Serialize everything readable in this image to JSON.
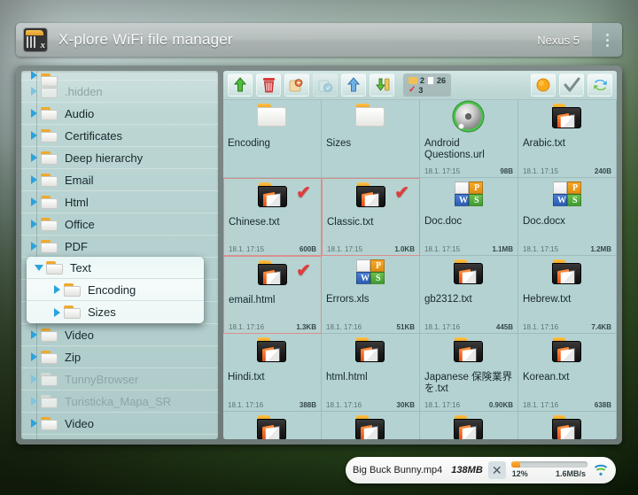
{
  "titlebar": {
    "app_icon": "xplore-app-icon",
    "title": "X-plore WiFi file manager",
    "device": "Nexus 5",
    "overflow_icon": "overflow-menu-icon"
  },
  "tree": {
    "items": [
      {
        "label": ".hidden",
        "state": "collapsed",
        "dim": true,
        "indent": 0
      },
      {
        "label": "Audio",
        "state": "collapsed",
        "dim": false,
        "indent": 0
      },
      {
        "label": "Certificates",
        "state": "collapsed",
        "dim": false,
        "indent": 0
      },
      {
        "label": "Deep hierarchy",
        "state": "collapsed",
        "dim": false,
        "indent": 0
      },
      {
        "label": "Email",
        "state": "collapsed",
        "dim": false,
        "indent": 0
      },
      {
        "label": "Html",
        "state": "collapsed",
        "dim": false,
        "indent": 0
      },
      {
        "label": "Office",
        "state": "collapsed",
        "dim": false,
        "indent": 0
      },
      {
        "label": "PDF",
        "state": "collapsed",
        "dim": false,
        "indent": 0
      },
      {
        "label": "Text",
        "state": "expanded",
        "dim": false,
        "indent": 0
      },
      {
        "label": "Encoding",
        "state": "collapsed",
        "dim": false,
        "indent": 1
      },
      {
        "label": "Sizes",
        "state": "collapsed",
        "dim": false,
        "indent": 1
      },
      {
        "label": "Video",
        "state": "collapsed",
        "dim": false,
        "indent": 0
      },
      {
        "label": "Zip",
        "state": "collapsed",
        "dim": false,
        "indent": 0
      },
      {
        "label": "TunnyBrowser",
        "state": "collapsed",
        "dim": true,
        "indent": 0
      },
      {
        "label": "Turisticka_Mapa_SR",
        "state": "collapsed",
        "dim": true,
        "indent": 0
      },
      {
        "label": "Video",
        "state": "collapsed",
        "dim": false,
        "indent": 0
      }
    ],
    "popup": {
      "items": [
        {
          "label": "Text",
          "state": "expanded",
          "indent": 0
        },
        {
          "label": "Encoding",
          "state": "collapsed",
          "indent": 1
        },
        {
          "label": "Sizes",
          "state": "collapsed",
          "indent": 1
        }
      ]
    }
  },
  "toolbar": {
    "buttons": [
      {
        "name": "up-folder-button",
        "icon": "green-up-arrow-icon",
        "dimmed": false
      },
      {
        "name": "delete-button",
        "icon": "trash-icon",
        "dimmed": false
      },
      {
        "name": "copy-button",
        "icon": "copy-icon",
        "dimmed": false
      },
      {
        "name": "paste-button",
        "icon": "paste-icon",
        "dimmed": true
      },
      {
        "name": "upload-button",
        "icon": "blue-up-arrow-icon",
        "dimmed": false
      },
      {
        "name": "download-button",
        "icon": "download-icon",
        "dimmed": false
      }
    ],
    "counts": {
      "folders": "2",
      "files": "26",
      "checked": "3"
    },
    "right_buttons": [
      {
        "name": "theme-button",
        "icon": "orange-circle-icon"
      },
      {
        "name": "select-all-button",
        "icon": "checkmark-icon"
      },
      {
        "name": "refresh-button",
        "icon": "refresh-arrows-icon"
      }
    ]
  },
  "files": {
    "items": [
      {
        "name": "Encoding",
        "kind": "folder",
        "date": "",
        "size": "",
        "selected": false,
        "checked": false
      },
      {
        "name": "Sizes",
        "kind": "folder",
        "date": "",
        "size": "",
        "selected": false,
        "checked": false
      },
      {
        "name": "Android Questions.url",
        "kind": "url",
        "date": "18.1. 17:15",
        "size": "98B",
        "selected": false,
        "checked": false
      },
      {
        "name": "Arabic.txt",
        "kind": "text",
        "date": "18.1. 17:15",
        "size": "240B",
        "selected": false,
        "checked": false
      },
      {
        "name": "Chinese.txt",
        "kind": "text",
        "date": "18.1. 17:15",
        "size": "600B",
        "selected": true,
        "checked": true
      },
      {
        "name": "Classic.txt",
        "kind": "text",
        "date": "18.1. 17:15",
        "size": "1.0KB",
        "selected": true,
        "checked": true
      },
      {
        "name": "Doc.doc",
        "kind": "office",
        "date": "18.1. 17:15",
        "size": "1.1MB",
        "selected": false,
        "checked": false
      },
      {
        "name": "Doc.docx",
        "kind": "office",
        "date": "18.1. 17:15",
        "size": "1.2MB",
        "selected": false,
        "checked": false
      },
      {
        "name": "email.html",
        "kind": "text",
        "date": "18.1. 17:16",
        "size": "1.3KB",
        "selected": true,
        "checked": true
      },
      {
        "name": "Errors.xls",
        "kind": "office",
        "date": "18.1. 17:16",
        "size": "51KB",
        "selected": false,
        "checked": false
      },
      {
        "name": "gb2312.txt",
        "kind": "text",
        "date": "18.1. 17:16",
        "size": "445B",
        "selected": false,
        "checked": false
      },
      {
        "name": "Hebrew.txt",
        "kind": "text",
        "date": "18.1. 17:16",
        "size": "7.4KB",
        "selected": false,
        "checked": false
      },
      {
        "name": "Hindi.txt",
        "kind": "text",
        "date": "18.1. 17:16",
        "size": "388B",
        "selected": false,
        "checked": false
      },
      {
        "name": "html.html",
        "kind": "text",
        "date": "18.1. 17:16",
        "size": "30KB",
        "selected": false,
        "checked": false
      },
      {
        "name": "Japanese 保険業界を.txt",
        "kind": "text",
        "date": "18.1. 17:16",
        "size": "0.90KB",
        "selected": false,
        "checked": false
      },
      {
        "name": "Korean.txt",
        "kind": "text",
        "date": "18.1. 17:16",
        "size": "638B",
        "selected": false,
        "checked": false
      },
      {
        "name": "",
        "kind": "text",
        "date": "",
        "size": "",
        "selected": false,
        "checked": false
      },
      {
        "name": "",
        "kind": "text",
        "date": "",
        "size": "",
        "selected": false,
        "checked": false
      },
      {
        "name": "",
        "kind": "text",
        "date": "",
        "size": "",
        "selected": false,
        "checked": false
      },
      {
        "name": "",
        "kind": "text",
        "date": "",
        "size": "",
        "selected": false,
        "checked": false
      }
    ]
  },
  "transfer": {
    "filename": "Big Buck Bunny.mp4",
    "size": "138MB",
    "cancel_icon": "close-icon",
    "percent": "12%",
    "percent_value": 12,
    "speed": "1.6MB/s",
    "wifi_icon": "wifi-transfer-icon"
  },
  "colors": {
    "accent_orange": "#f0a92b",
    "check_red": "#e03c3c",
    "selection_border": "#d98f8f",
    "pane_bg": "#b4d2d1",
    "tree_bg": "#bcd6d4"
  }
}
